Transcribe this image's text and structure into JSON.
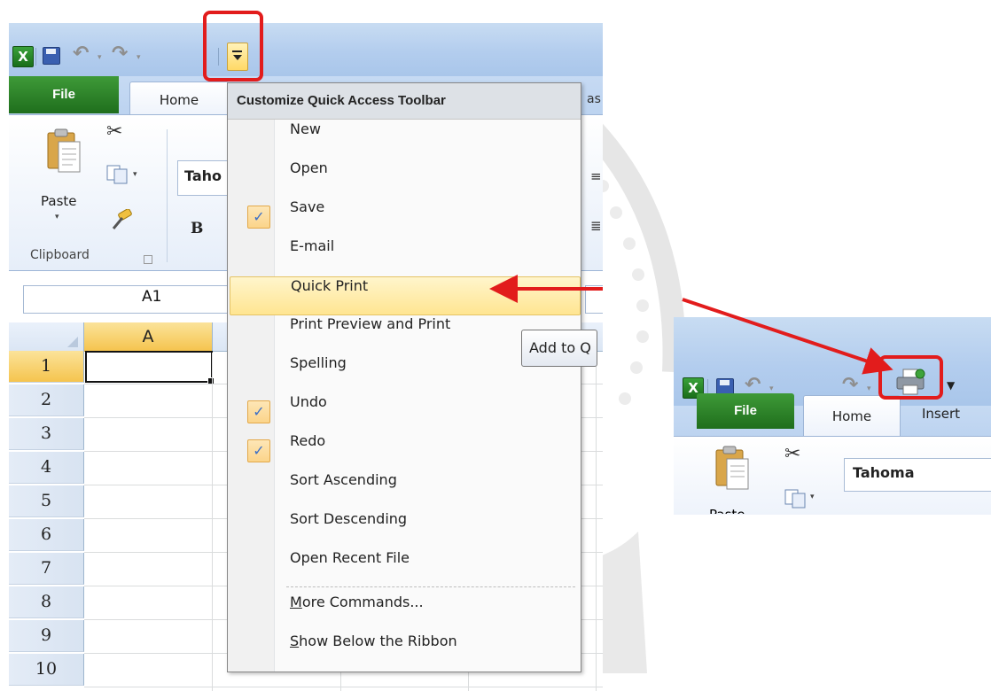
{
  "qat_menu": {
    "title": "Customize Quick Access Toolbar",
    "items": [
      {
        "label": "New",
        "checked": false
      },
      {
        "label": "Open",
        "checked": false
      },
      {
        "label": "Save",
        "checked": true
      },
      {
        "label": "E-mail",
        "checked": false
      },
      {
        "label": "Quick Print",
        "checked": false,
        "highlighted": true
      },
      {
        "label": "Print Preview and Print",
        "checked": false
      },
      {
        "label": "Spelling",
        "checked": false
      },
      {
        "label": "Undo",
        "checked": true
      },
      {
        "label": "Redo",
        "checked": true
      },
      {
        "label": "Sort Ascending",
        "checked": false
      },
      {
        "label": "Sort Descending",
        "checked": false
      },
      {
        "label": "Open Recent File",
        "checked": false
      },
      {
        "label": "More Commands...",
        "checked": false
      },
      {
        "label": "Show Below the Ribbon",
        "checked": false
      }
    ],
    "check_mark": "✓"
  },
  "tooltip": "Add to Q",
  "excel_left": {
    "app_icon": "X",
    "tabs": {
      "file": "File",
      "home": "Home",
      "partial": "as"
    },
    "clipboard": {
      "paste_label": "Paste",
      "group_label": "Clipboard"
    },
    "font_box": "Taho",
    "bold_label": "B",
    "name_box": "A1",
    "column_header": "A",
    "row_numbers": [
      "1",
      "2",
      "3",
      "4",
      "5",
      "6",
      "7",
      "8",
      "9",
      "10"
    ],
    "active_row": "1"
  },
  "excel_right": {
    "app_icon": "X",
    "tabs": {
      "file": "File",
      "home": "Home",
      "insert": "Insert"
    },
    "font_box": "Tahoma",
    "paste_partial": "Paste"
  },
  "icons": {
    "save": "save-icon",
    "undo": "undo-icon",
    "redo": "redo-icon",
    "customize": "customize-qat-icon",
    "quick_print": "quick-print-icon",
    "cut": "scissors-icon",
    "copy": "copy-icon",
    "paste": "paste-icon",
    "format_painter": "format-painter-icon"
  },
  "colors": {
    "annotation_red": "#e21c1c",
    "file_tab_green": "#2a7f26",
    "highlight_yellow": "#ffe591",
    "ribbon_blue": "#b3cdee"
  }
}
